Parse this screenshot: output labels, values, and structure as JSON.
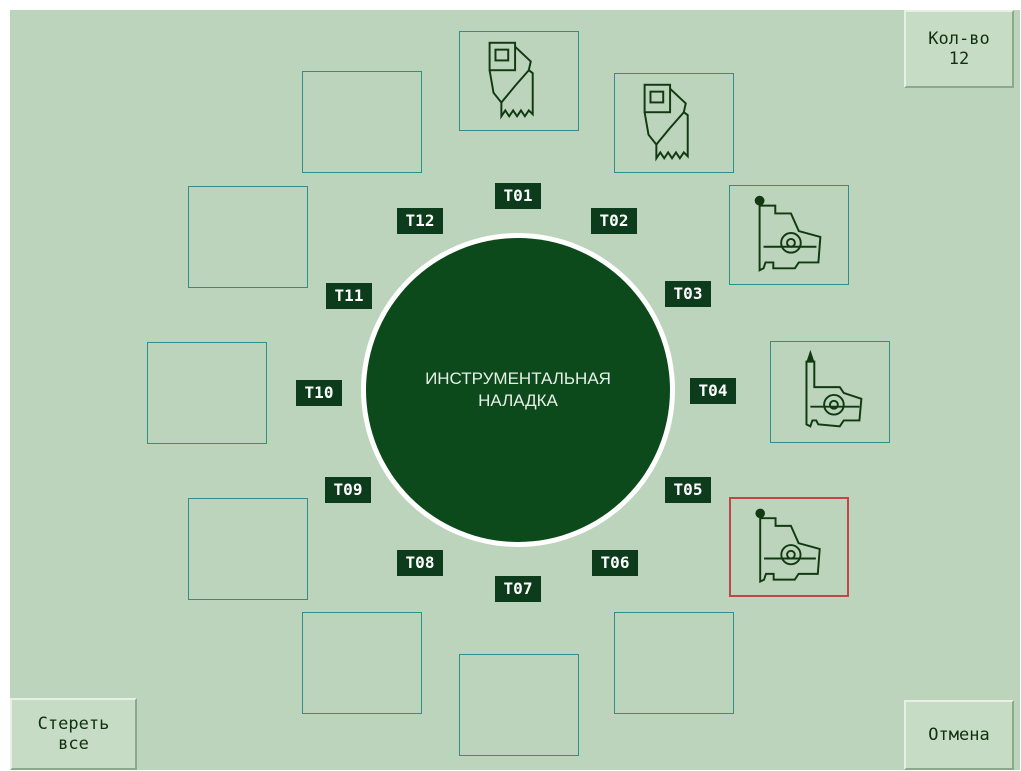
{
  "turret": {
    "title_line1": "ИНСТРУМЕНТАЛЬНАЯ",
    "title_line2": "НАЛАДКА"
  },
  "buttons": {
    "count_label": "Кол-во",
    "count_value": "12",
    "clear_line1": "Стереть",
    "clear_line2": "все",
    "cancel": "Отмена"
  },
  "tools": [
    {
      "label": "T01",
      "icon": "groove-tool-icon",
      "selected": false
    },
    {
      "label": "T02",
      "icon": "groove-tool-icon",
      "selected": false
    },
    {
      "label": "T03",
      "icon": "turning-tool-holder-icon",
      "selected": false
    },
    {
      "label": "T04",
      "icon": "drill-holder-icon",
      "selected": false
    },
    {
      "label": "T05",
      "icon": "turning-tool-holder-icon",
      "selected": true
    },
    {
      "label": "T06",
      "icon": "",
      "selected": false
    },
    {
      "label": "T07",
      "icon": "",
      "selected": false
    },
    {
      "label": "T08",
      "icon": "",
      "selected": false
    },
    {
      "label": "T09",
      "icon": "",
      "selected": false
    },
    {
      "label": "T10",
      "icon": "",
      "selected": false
    },
    {
      "label": "T11",
      "icon": "",
      "selected": false
    },
    {
      "label": "T12",
      "icon": "",
      "selected": false
    }
  ],
  "colors": {
    "background": "#bcd4bb",
    "slot_border": "#2f8f8b",
    "selected_border": "#c0464a",
    "turret_fill": "#0c4a1c",
    "label_fill": "#0c3c1c"
  }
}
